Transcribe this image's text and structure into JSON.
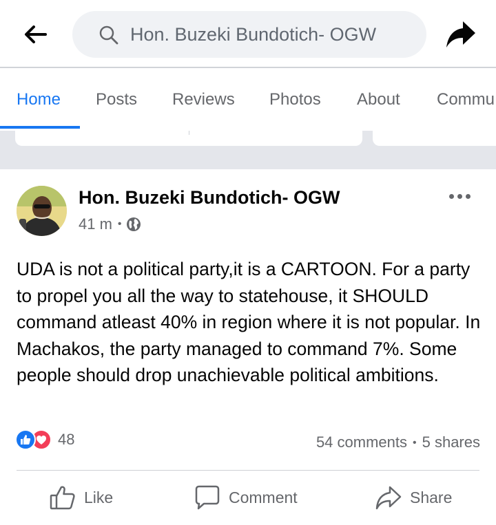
{
  "search": {
    "query": "Hon. Buzeki Bundotich- OGW"
  },
  "tabs": [
    {
      "label": "Home"
    },
    {
      "label": "Posts"
    },
    {
      "label": "Reviews"
    },
    {
      "label": "Photos"
    },
    {
      "label": "About"
    },
    {
      "label": "Commu"
    }
  ],
  "post": {
    "author": "Hon. Buzeki Bundotich- OGW",
    "time": "41 m",
    "audience_icon": "globe-icon",
    "text": "UDA is not a political party,it is a CARTOON. For a party to propel you all the way to statehouse, it SHOULD command atleast 40% in region where it is not popular. In Machakos, the party managed to command 7%. Some people should drop unachievable political ambitions.",
    "reaction_count": "48",
    "comments": "54 comments",
    "shares": "5 shares",
    "actions": {
      "like": "Like",
      "comment": "Comment",
      "share": "Share"
    }
  },
  "colors": {
    "accent": "#1877f2",
    "love": "#f33e58",
    "secondary_text": "#65676b"
  }
}
